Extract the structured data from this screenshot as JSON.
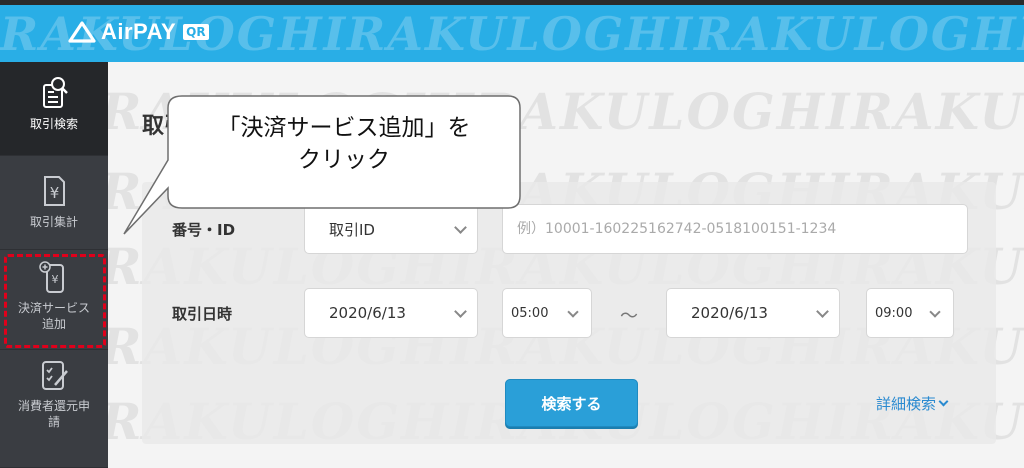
{
  "header": {
    "logo_text": "AirPAY",
    "logo_badge": "QR",
    "watermark": "RAKULOGHIRAKULOGHIRAKULOGHIRAKULOGHIRAKULOG"
  },
  "sidebar": {
    "items": [
      {
        "label": "取引検索",
        "icon": "search-document-icon",
        "active": true
      },
      {
        "label": "取引集計",
        "icon": "yen-document-icon",
        "active": false
      },
      {
        "label": "決済サービス追加",
        "icon": "add-payment-phone-icon",
        "active": false
      },
      {
        "label": "消費者還元申請",
        "icon": "checklist-edit-icon",
        "active": false
      }
    ]
  },
  "main": {
    "page_title": "取引検索",
    "watermark": "RAKULOGHIRAKULOGHIRAKULOGHIRA"
  },
  "search_form": {
    "number_label": "番号・ID",
    "id_type_value": "取引ID",
    "id_placeholder": "例）10001-160225162742-0518100151-1234",
    "date_label": "取引日時",
    "from_date": "2020/6/13",
    "from_time": "05:00",
    "range_separator": "〜",
    "to_date": "2020/6/13",
    "to_time": "09:00",
    "search_button": "検索する",
    "detail_link": "詳細検索"
  },
  "callout": {
    "line1": "「決済サービス追加」を",
    "line2": "クリック"
  },
  "colors": {
    "header_blue": "#29aee6",
    "sidebar_dark": "#3a3d42",
    "button_blue": "#2a9fd8",
    "highlight_red": "#e0001b"
  }
}
